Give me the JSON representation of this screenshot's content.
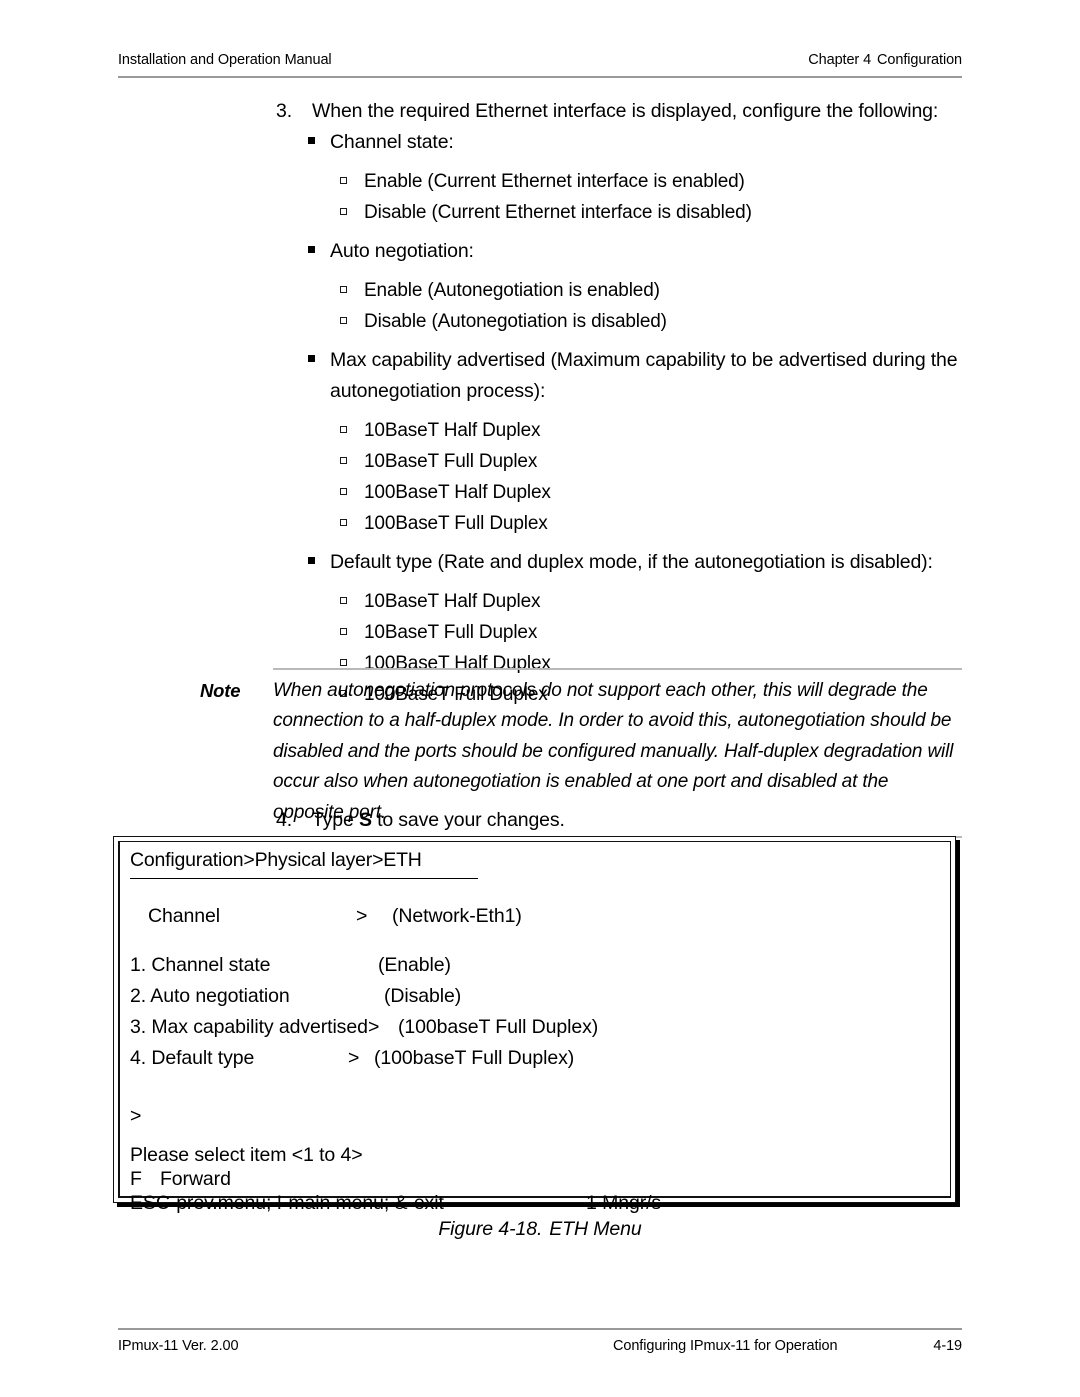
{
  "header": {
    "left": "Installation and Operation Manual",
    "right_chapter": "Chapter 4",
    "right_title": "Configuration"
  },
  "steps": {
    "step3_num": "3.",
    "step3_text": "When the required Ethernet interface is displayed, configure the following:",
    "step4_num": "4.",
    "step4_prefix": "Type ",
    "step4_key": "S",
    "step4_suffix": " to save your changes."
  },
  "bullets": {
    "channel_state": {
      "title": "Channel state:",
      "options": [
        "Enable (Current Ethernet interface is enabled)",
        "Disable (Current Ethernet interface is disabled)"
      ]
    },
    "auto_negotiation": {
      "title": "Auto negotiation:",
      "options": [
        "Enable (Autonegotiation is enabled)",
        "Disable (Autonegotiation is disabled)"
      ]
    },
    "max_capability": {
      "title": "Max capability advertised (Maximum capability to be advertised during the autonegotiation process):",
      "options": [
        "10BaseT Half Duplex",
        "10BaseT Full Duplex",
        "100BaseT Half Duplex",
        "100BaseT Full Duplex"
      ]
    },
    "default_type": {
      "title": "Default type (Rate and duplex mode, if the autonegotiation is disabled):",
      "options": [
        "10BaseT Half Duplex",
        "10BaseT Full Duplex",
        "100BaseT Half Duplex",
        "100BaseT Full Duplex"
      ]
    }
  },
  "note": {
    "label": "Note",
    "text": "When autonegotiation protocols do not support each other, this will degrade the connection to a half-duplex mode. In order to avoid this, autonegotiation should be disabled and the ports should be configured manually. Half-duplex degradation will occur also when autonegotiation is enabled at one port and disabled at the opposite port."
  },
  "terminal": {
    "breadcrumb": "Configuration>Physical layer>ETH",
    "channel_label": "Channel",
    "channel_arrow": ">",
    "channel_value": "(Network-Eth1)",
    "menu_items": [
      {
        "label": "1. Channel state",
        "arrow": "",
        "value": "(Enable)"
      },
      {
        "label": "2. Auto negotiation",
        "arrow": "",
        "value": "(Disable)"
      },
      {
        "label": "3. Max capability advertised",
        "arrow": ">",
        "value": "(100baseT Full Duplex)"
      },
      {
        "label": "4. Default type",
        "arrow": ">",
        "value": "(100baseT Full Duplex)"
      }
    ],
    "prompt": ">",
    "select_hint": "Please select item <1 to 4>",
    "forward_key": "F",
    "forward_label": "Forward",
    "keys_hint": "ESC-prev.menu; !-main menu; &-exit",
    "manager_status": "1 Mngr/s"
  },
  "figure": {
    "number": "Figure 4-18.",
    "title": "ETH Menu"
  },
  "footer": {
    "left": "IPmux-11 Ver. 2.00",
    "middle": "Configuring IPmux-11 for Operation",
    "right": "4-19"
  }
}
